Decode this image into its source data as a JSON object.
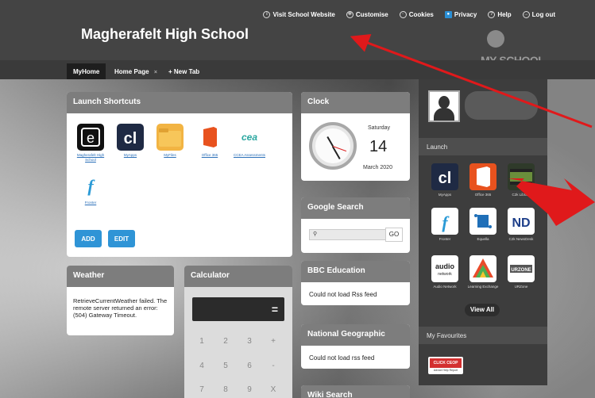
{
  "header": {
    "links": [
      {
        "label": "Visit School Website",
        "icon": "info-icon"
      },
      {
        "label": "Customise",
        "icon": "gear-icon"
      },
      {
        "label": "Cookies",
        "icon": "cookie-icon"
      },
      {
        "label": "Privacy",
        "icon": "user-icon"
      },
      {
        "label": "Help",
        "icon": "help-icon"
      },
      {
        "label": "Log out",
        "icon": "logout-icon"
      }
    ],
    "school_name": "Magherafelt High School",
    "logo_text": "MY-SCHOOL"
  },
  "tabs": [
    {
      "label": "MyHome",
      "active": true
    },
    {
      "label": "Home Page",
      "close": "×"
    },
    {
      "label": "+ New Tab"
    }
  ],
  "launch_shortcuts": {
    "title": "Launch Shortcuts",
    "items": [
      {
        "label": "Magherafelt High School",
        "icon": "e-icon"
      },
      {
        "label": "MyApps",
        "icon": "c2k-icon"
      },
      {
        "label": "MyFiles",
        "icon": "folder-icon"
      },
      {
        "label": "Office 365",
        "icon": "office-icon"
      },
      {
        "label": "CCEA Assessments",
        "icon": "ccea-icon"
      },
      {
        "label": "Fronter",
        "icon": "fronter-icon"
      }
    ],
    "add_label": "ADD",
    "edit_label": "EDIT"
  },
  "clock": {
    "title": "Clock",
    "day": "Saturday",
    "date": "14",
    "month_year": "March 2020"
  },
  "google_search": {
    "title": "Google Search",
    "placeholder": "",
    "go_label": "GO"
  },
  "bbc_education": {
    "title": "BBC Education",
    "message": "Could not load Rss feed"
  },
  "national_geographic": {
    "title": "National Geographic",
    "message": "Could not load rss feed"
  },
  "wiki_search": {
    "title": "Wiki Search"
  },
  "weather": {
    "title": "Weather",
    "message": "RetrieveCurrentWeather failed. The remote server returned an error: (504) Gateway Timeout."
  },
  "calculator": {
    "title": "Calculator",
    "equals": "=",
    "keys": [
      "1",
      "2",
      "3",
      "+",
      "4",
      "5",
      "6",
      "-",
      "7",
      "8",
      "9",
      "X"
    ]
  },
  "right_panel": {
    "launch_label": "Launch",
    "launch_items": [
      {
        "label": "MyApps",
        "icon": "c2k-icon"
      },
      {
        "label": "Office 365",
        "icon": "office-icon"
      },
      {
        "label": "C2k Library",
        "icon": "library-icon"
      },
      {
        "label": "Fronter",
        "icon": "fronter-icon"
      },
      {
        "label": "Equella",
        "icon": "equella-icon"
      },
      {
        "label": "C2k NewsDesk",
        "icon": "newsdesk-icon"
      },
      {
        "label": "Audio Network",
        "icon": "audio-network-icon"
      },
      {
        "label": "Learning Exchange",
        "icon": "learning-exchange-icon"
      },
      {
        "label": "URZone",
        "icon": "urzone-icon"
      }
    ],
    "view_all": "View All",
    "favourites_label": "My Favourites",
    "ceop": {
      "top": "CLICK CEOP",
      "bottom": "Advice Help Report"
    }
  },
  "colors": {
    "header_bg": "#444444",
    "widget_header": "#7d7d7d",
    "accent_blue": "#2f94d6",
    "annotation_red": "#e0191b"
  }
}
